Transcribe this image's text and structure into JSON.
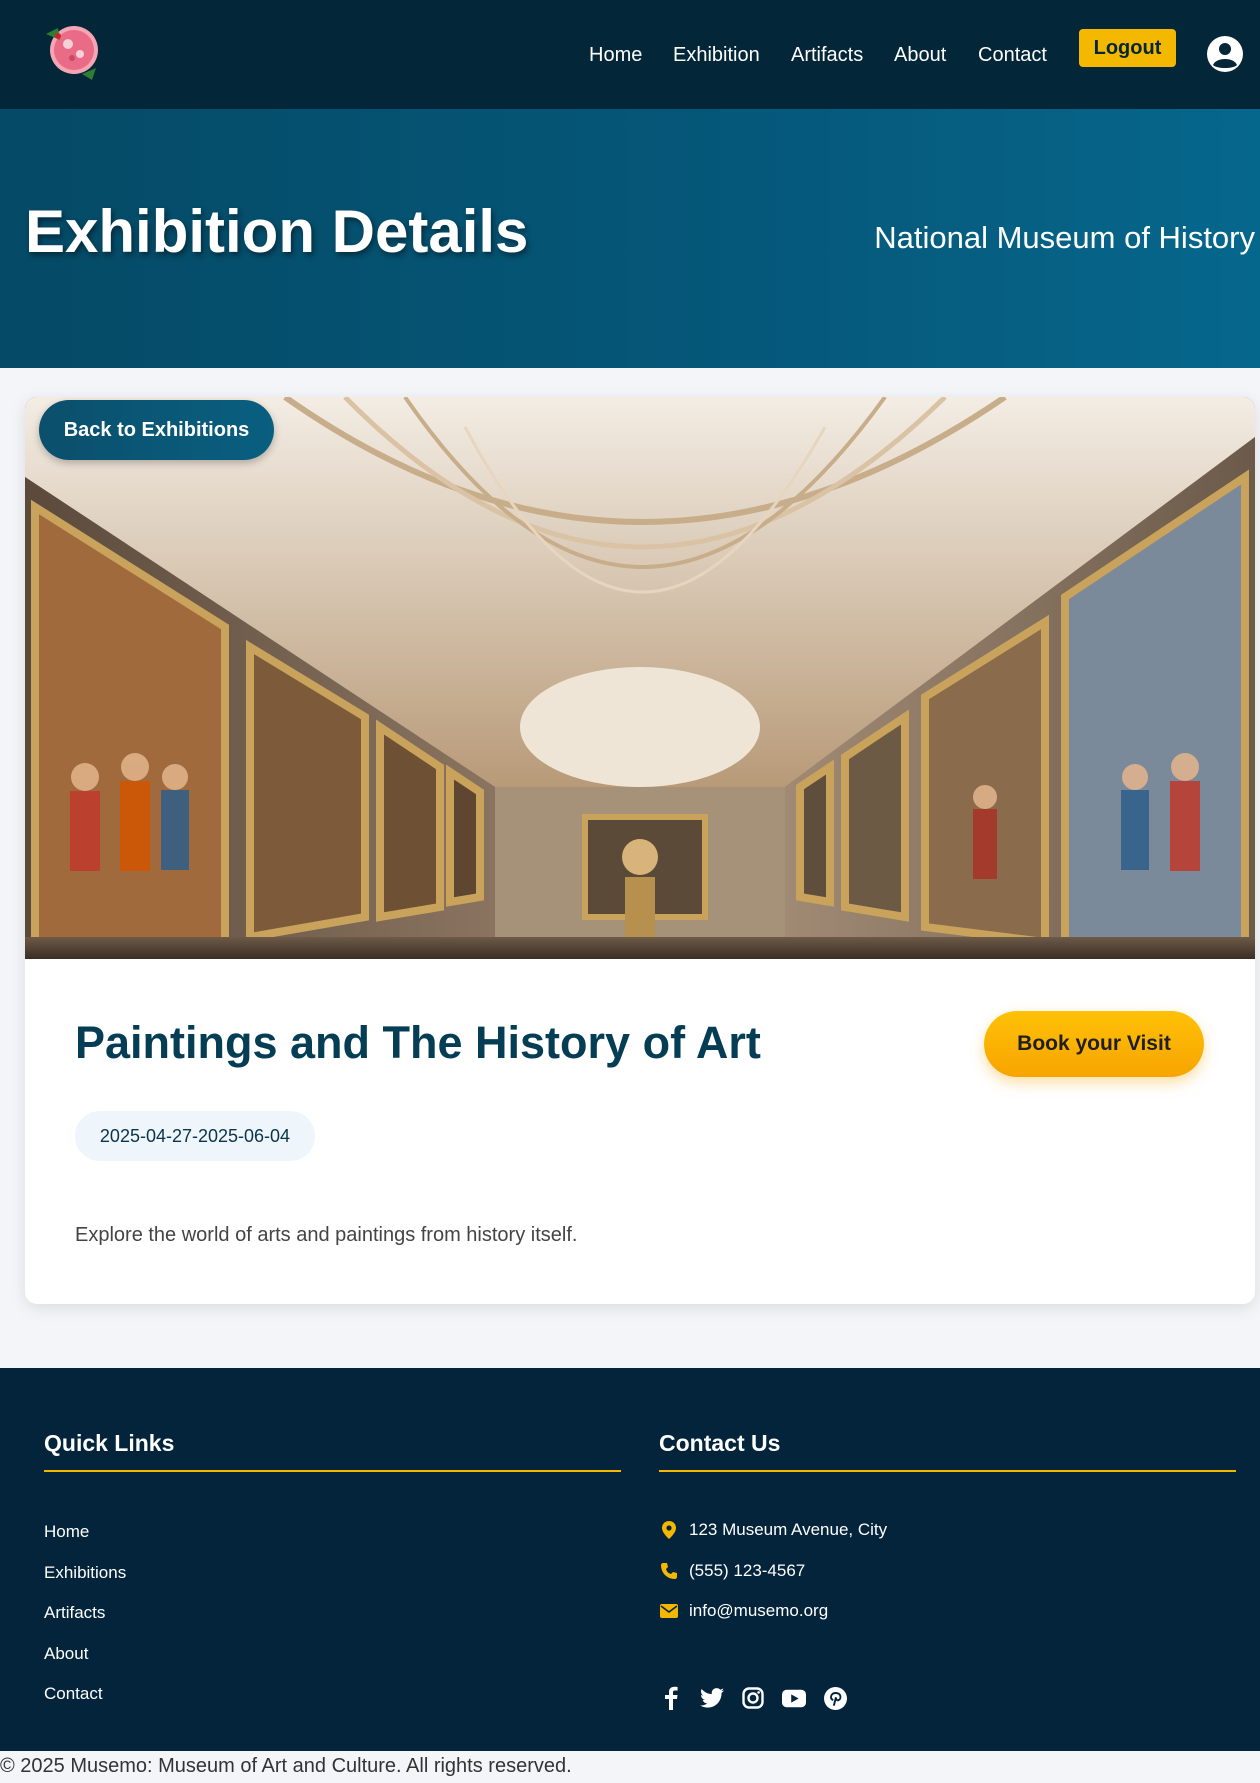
{
  "nav": {
    "links": [
      "Home",
      "Exhibition",
      "Artifacts",
      "About",
      "Contact"
    ],
    "logout_label": "Logout"
  },
  "hero": {
    "title": "Exhibition Details",
    "subtitle": "National Museum of History"
  },
  "exhibition": {
    "back_label": "Back to Exhibitions",
    "title": "Paintings and The History of Art",
    "book_label": "Book your Visit",
    "dates": "2025-04-27-2025-06-04",
    "description": "Explore the world of arts and paintings from history itself."
  },
  "footer": {
    "quick_links_heading": "Quick Links",
    "quick_links": [
      "Home",
      "Exhibitions",
      "Artifacts",
      "About",
      "Contact"
    ],
    "contact_heading": "Contact Us",
    "address": "123 Museum Avenue, City",
    "phone": "(555) 123-4567",
    "email": "info@musemo.org",
    "socials": [
      "facebook-icon",
      "twitter-icon",
      "instagram-icon",
      "youtube-icon",
      "pinterest-icon"
    ]
  },
  "copyright": "© 2025 Musemo: Museum of Art and Culture. All rights reserved.",
  "colors": {
    "navy": "#032638",
    "hero_blue": "#05587a",
    "accent_yellow": "#f5b800",
    "title_blue": "#053d55"
  }
}
